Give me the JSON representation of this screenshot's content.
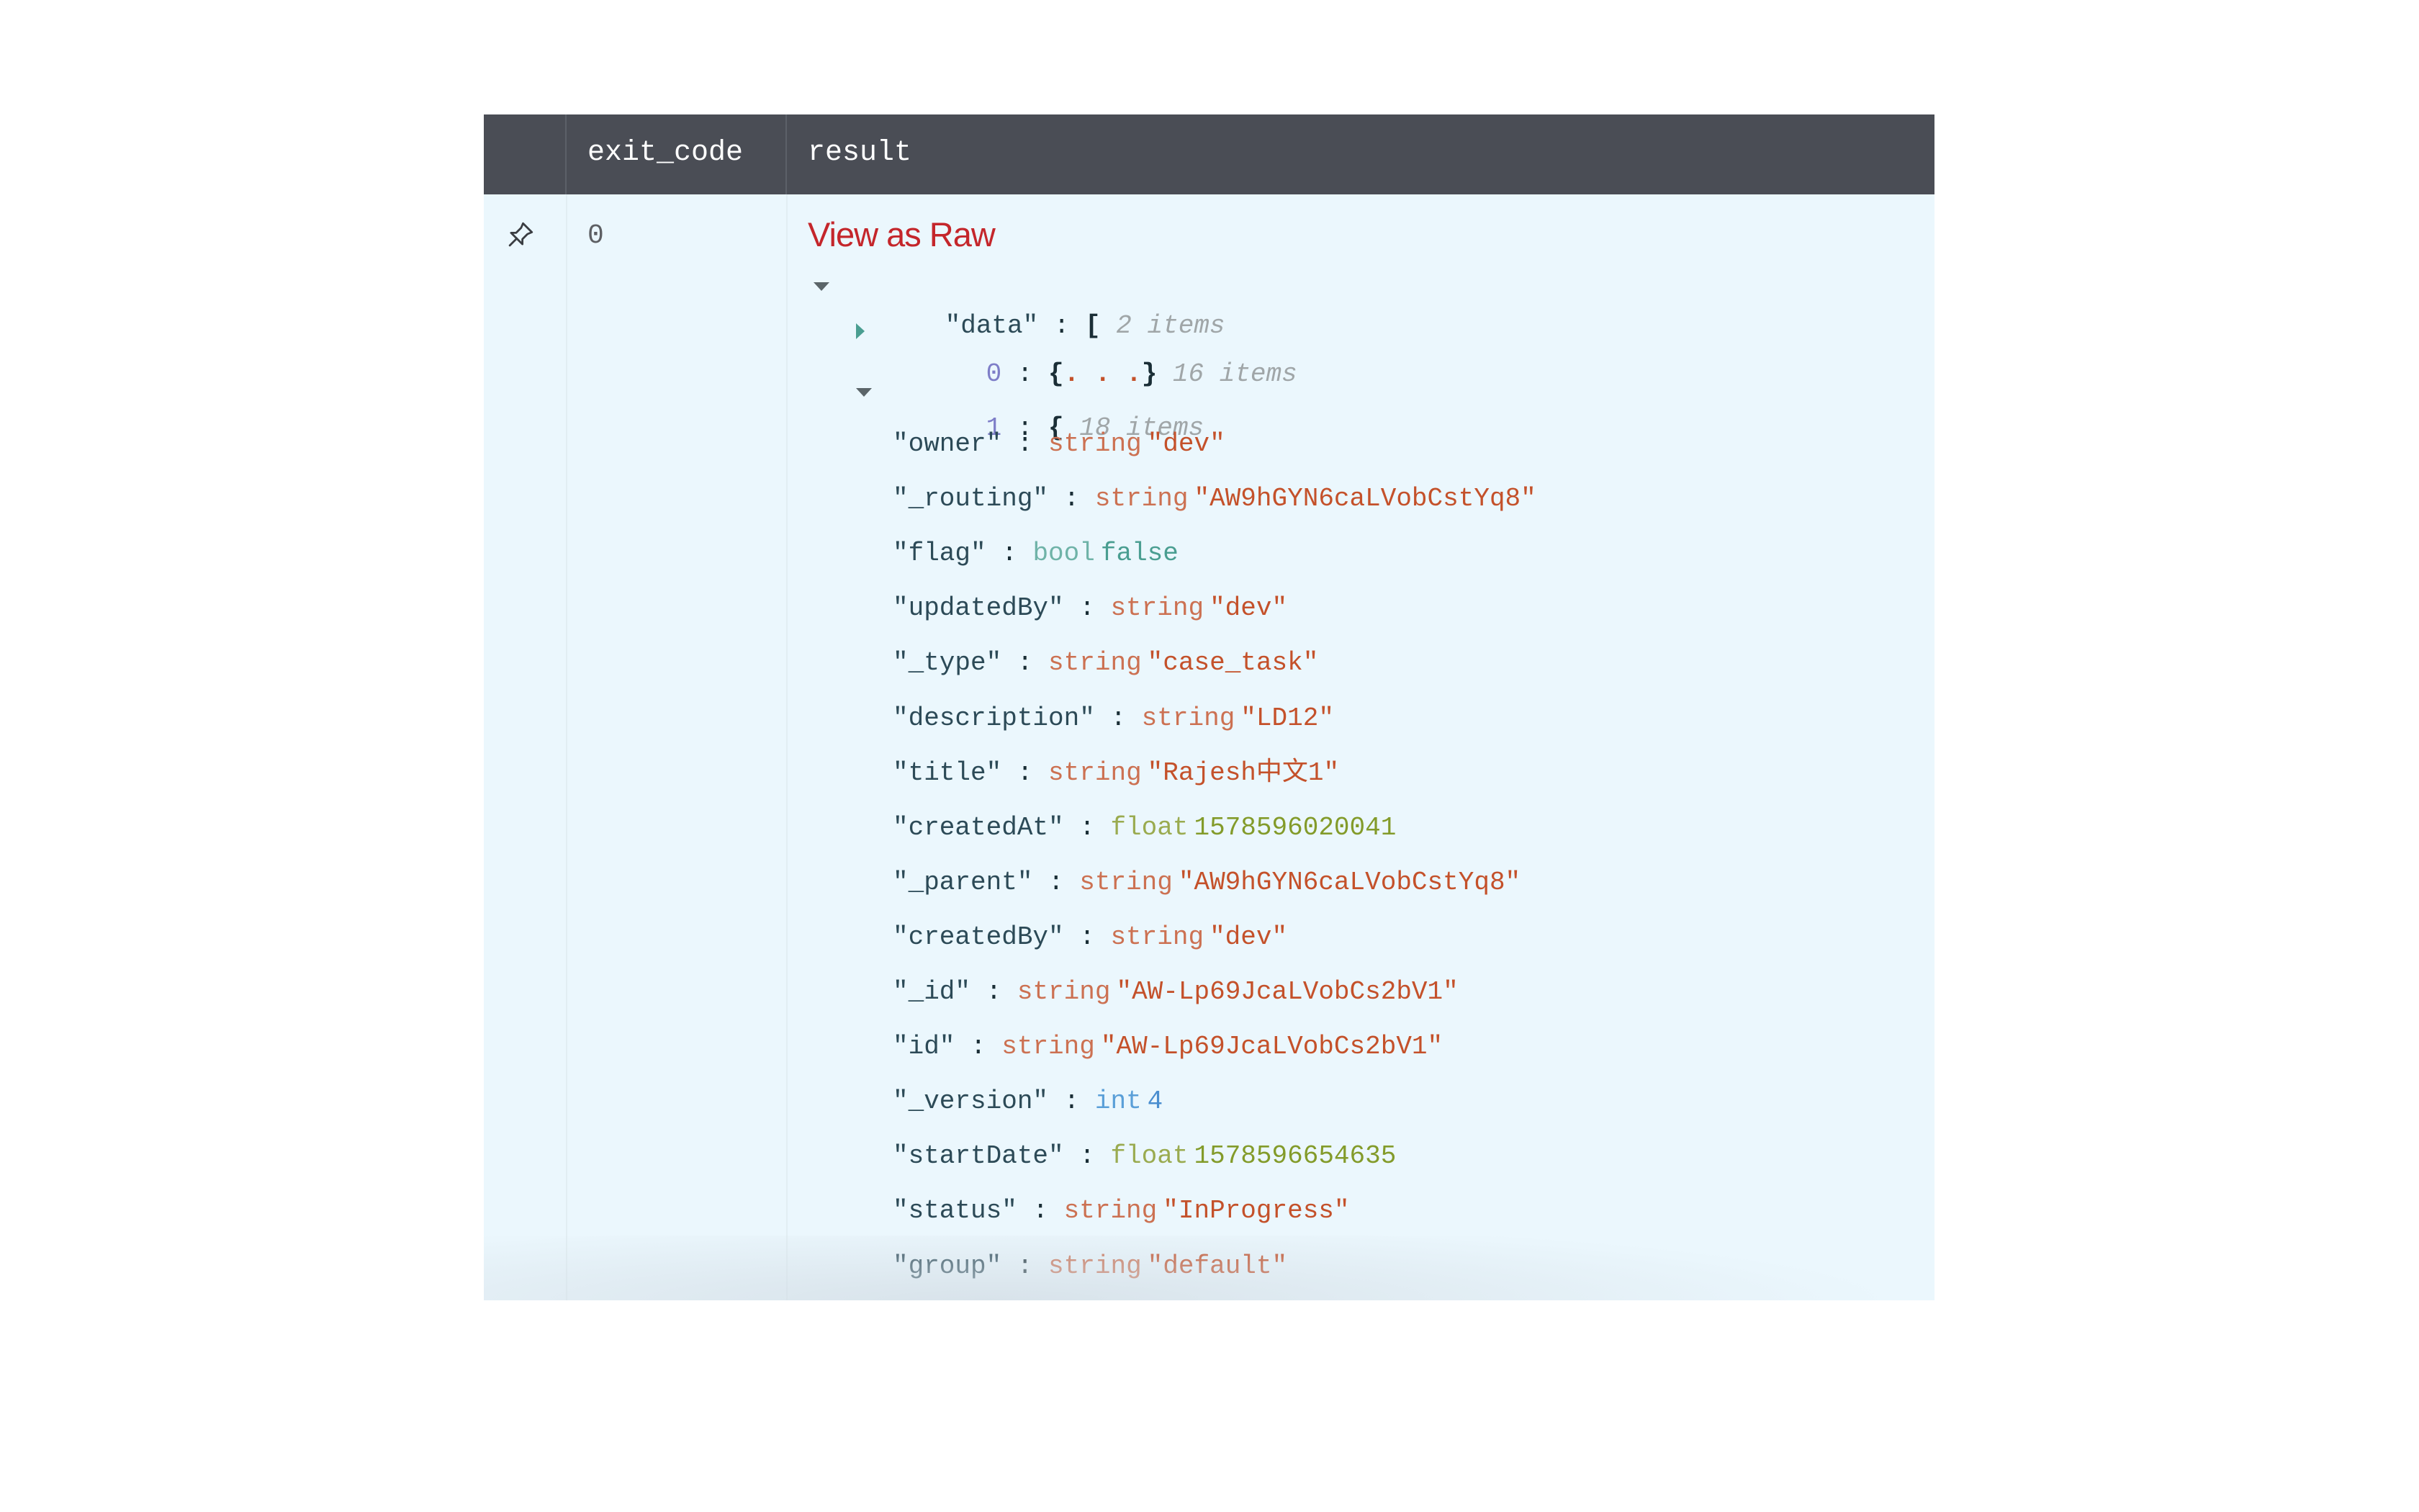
{
  "table": {
    "columns": [
      "",
      "exit_code",
      "result"
    ],
    "row": {
      "pin_icon": "pin-icon",
      "exit_code": "0",
      "view_raw_label": "View as Raw"
    }
  },
  "tree": {
    "root": {
      "key": "\"data\"",
      "colon": " : ",
      "open": "[",
      "count": "2 items",
      "expanded": true
    },
    "item0": {
      "index": "0",
      "colon": " : ",
      "open": "{",
      "dots": ". . .",
      "close": "}",
      "count": "16 items",
      "expanded": false
    },
    "item1": {
      "index": "1",
      "colon": " : ",
      "open": "{",
      "count": "18 items",
      "expanded": true
    },
    "fields": [
      {
        "key": "\"owner\"",
        "type": "string",
        "value": "\"dev\""
      },
      {
        "key": "\"_routing\"",
        "type": "string",
        "value": "\"AW9hGYN6caLVobCstYq8\""
      },
      {
        "key": "\"flag\"",
        "type": "bool",
        "value": "false"
      },
      {
        "key": "\"updatedBy\"",
        "type": "string",
        "value": "\"dev\""
      },
      {
        "key": "\"_type\"",
        "type": "string",
        "value": "\"case_task\""
      },
      {
        "key": "\"description\"",
        "type": "string",
        "value": "\"LD12\""
      },
      {
        "key": "\"title\"",
        "type": "string",
        "value": "\"Rajesh中文1\""
      },
      {
        "key": "\"createdAt\"",
        "type": "float",
        "value": "1578596020041"
      },
      {
        "key": "\"_parent\"",
        "type": "string",
        "value": "\"AW9hGYN6caLVobCstYq8\""
      },
      {
        "key": "\"createdBy\"",
        "type": "string",
        "value": "\"dev\""
      },
      {
        "key": "\"_id\"",
        "type": "string",
        "value": "\"AW-Lp69JcaLVobCs2bV1\""
      },
      {
        "key": "\"id\"",
        "type": "string",
        "value": "\"AW-Lp69JcaLVobCs2bV1\""
      },
      {
        "key": "\"_version\"",
        "type": "int",
        "value": "4"
      },
      {
        "key": "\"startDate\"",
        "type": "float",
        "value": "1578596654635"
      },
      {
        "key": "\"status\"",
        "type": "string",
        "value": "\"InProgress\""
      },
      {
        "key": "\"group\"",
        "type": "string",
        "value": "\"default\""
      }
    ],
    "colon": " : "
  },
  "colors": {
    "header_bg": "#4a4d55",
    "row_bg": "#ebf7fd",
    "view_raw": "#c4262b",
    "string_value": "#c4512a",
    "bool_value": "#4a9e91",
    "float_value": "#839b2a",
    "int_value": "#4a8ed0",
    "index": "#7e7ec8"
  }
}
